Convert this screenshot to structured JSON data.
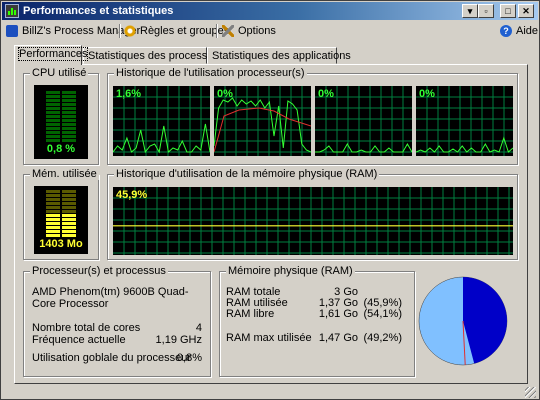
{
  "window": {
    "title": "Performances et statistiques"
  },
  "menu": {
    "items": [
      {
        "label": "BillZ's Process Manager",
        "icon": "app-logo-icon"
      },
      {
        "label": "Règles et groupes",
        "icon": "rules-gear-icon"
      },
      {
        "label": "Options",
        "icon": "options-tools-icon"
      },
      {
        "label": "Aide",
        "icon": "help-icon"
      }
    ]
  },
  "tabs": [
    {
      "label": "Performances",
      "active": true
    },
    {
      "label": "Statistiques des processeurs",
      "active": false
    },
    {
      "label": "Statistiques des applications",
      "active": false
    }
  ],
  "cpu": {
    "group_title": "CPU utilisé",
    "value_text": "0,8 %",
    "level": 0.008,
    "history_title": "Historique de l'utilisation processeur(s)",
    "cores": [
      "1,6%",
      "0%",
      "0%",
      "0%"
    ]
  },
  "memory": {
    "group_title": "Mém. utilisée",
    "value_text": "1403 Mo",
    "level": 0.459,
    "history_title": "Historique d'utilisation de la mémoire physique (RAM)",
    "graph_label": "45,9%"
  },
  "processors": {
    "group_title": "Processeur(s) et processus",
    "model": "AMD Phenom(tm) 9600B Quad-Core Processor",
    "rows": [
      {
        "label": "Nombre total de cores",
        "value": "4"
      },
      {
        "label": "Fréquence actuelle",
        "value": "1,19 GHz"
      },
      {
        "label": "Utilisation goblale du processeur",
        "value": "0,8%"
      }
    ]
  },
  "ram": {
    "group_title": "Mémoire physique (RAM)",
    "rows": [
      {
        "label": "RAM totale",
        "value": "3 Go",
        "pct": ""
      },
      {
        "label": "RAM utilisée",
        "value": "1,37 Go",
        "pct": "(45,9%)"
      },
      {
        "label": "RAM libre",
        "value": "1,61 Go",
        "pct": "(54,1%)"
      },
      {
        "label": "RAM max utilisée",
        "value": "1,47 Go",
        "pct": "(49,2%)"
      }
    ],
    "pie": {
      "used_fraction": 0.459,
      "max_fraction": 0.492,
      "used_color": "#0000c8",
      "free_color": "#80c0ff"
    }
  },
  "colors": {
    "graph_green": "#33ff33",
    "meter_yellow": "#ffff33",
    "grid": "#008040"
  }
}
